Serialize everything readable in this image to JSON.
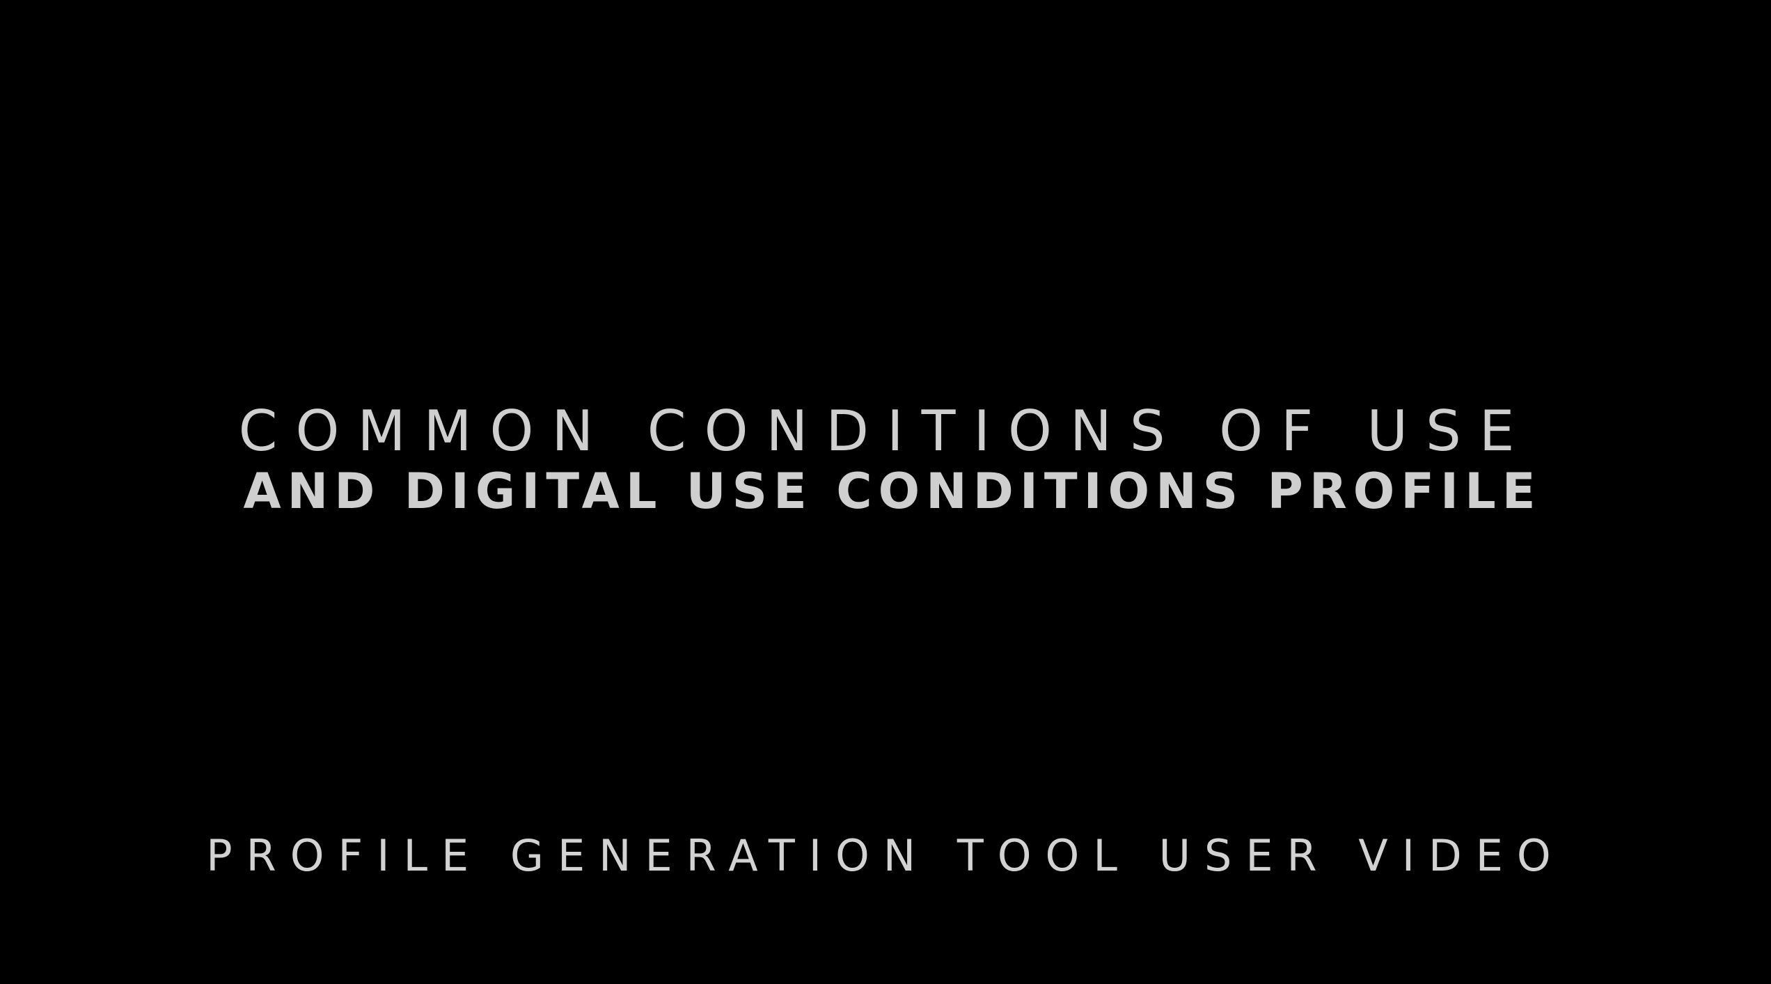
{
  "background_color": "#000000",
  "text_color": "#cfcfcf",
  "title": {
    "line1": "COMMON CONDITIONS OF USE",
    "line2": "AND DIGITAL USE CONDITIONS PROFILE"
  },
  "subtitle": "PROFILE GENERATION TOOL USER VIDEO"
}
